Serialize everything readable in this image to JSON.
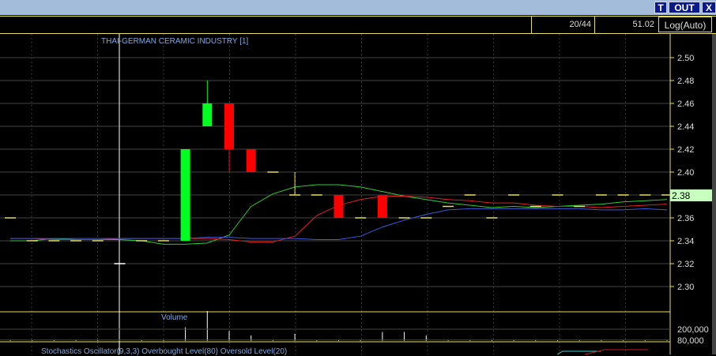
{
  "toolbar": {
    "t_label": "T",
    "out_label": "OUT",
    "x_label": "X"
  },
  "info": {
    "position": "20/44",
    "value": "51.02",
    "scale": "Log(Auto)"
  },
  "colors": {
    "up": "#00ff20",
    "down": "#ff0000",
    "ma_green": "#2ecc2e",
    "ma_red": "#e02020",
    "ma_blue": "#3a5ad8",
    "grid": "#444",
    "axis": "#e6e05a",
    "last_price_bg": "#c8ffc0"
  },
  "chart_data": {
    "type": "candlestick",
    "title": "THAI-GERMAN CERAMIC INDUSTRY [1]",
    "ylim": [
      2.29,
      2.51
    ],
    "yticks": [
      "2.50",
      "2.48",
      "2.46",
      "2.44",
      "2.42",
      "2.40",
      "2.38",
      "2.36",
      "2.34",
      "2.32",
      "2.30"
    ],
    "last_price": "2.38",
    "candles": [
      [
        2.36,
        2.36,
        2.36,
        2.36
      ],
      [
        2.34,
        2.34,
        2.34,
        2.34
      ],
      [
        2.34,
        2.34,
        2.34,
        2.34
      ],
      [
        2.34,
        2.34,
        2.34,
        2.34
      ],
      [
        2.34,
        2.34,
        2.34,
        2.34
      ],
      [
        2.32,
        2.32,
        2.32,
        2.32
      ],
      [
        2.34,
        2.34,
        2.34,
        2.34
      ],
      [
        2.34,
        2.34,
        2.34,
        2.34
      ],
      [
        2.34,
        2.42,
        2.34,
        2.42
      ],
      [
        2.44,
        2.48,
        2.44,
        2.46
      ],
      [
        2.46,
        2.46,
        2.4,
        2.42
      ],
      [
        2.42,
        2.42,
        2.4,
        2.4
      ],
      [
        2.4,
        2.4,
        2.4,
        2.4
      ],
      [
        2.38,
        2.4,
        2.38,
        2.38
      ],
      [
        2.38,
        2.38,
        2.38,
        2.38
      ],
      [
        2.38,
        2.38,
        2.36,
        2.36
      ],
      [
        2.36,
        2.36,
        2.36,
        2.36
      ],
      [
        2.38,
        2.38,
        2.36,
        2.36
      ],
      [
        2.36,
        2.36,
        2.36,
        2.36
      ],
      [
        2.36,
        2.36,
        2.36,
        2.36
      ],
      [
        2.37,
        2.37,
        2.37,
        2.37
      ],
      [
        2.38,
        2.38,
        2.38,
        2.38
      ],
      [
        2.36,
        2.36,
        2.36,
        2.36
      ],
      [
        2.38,
        2.38,
        2.38,
        2.38
      ],
      [
        2.37,
        2.37,
        2.37,
        2.37
      ],
      [
        2.38,
        2.38,
        2.38,
        2.38
      ],
      [
        2.37,
        2.37,
        2.37,
        2.37
      ],
      [
        2.38,
        2.38,
        2.38,
        2.38
      ],
      [
        2.38,
        2.38,
        2.38,
        2.38
      ],
      [
        2.38,
        2.38,
        2.38,
        2.38
      ],
      [
        2.38,
        2.38,
        2.38,
        2.38
      ]
    ],
    "series": [
      {
        "name": "ma-green",
        "values": [
          2.34,
          2.34,
          2.342,
          2.341,
          2.341,
          2.341,
          2.34,
          2.337,
          2.337,
          2.338,
          2.345,
          2.37,
          2.381,
          2.387,
          2.389,
          2.389,
          2.387,
          2.383,
          2.379,
          2.376,
          2.373,
          2.371,
          2.369,
          2.37,
          2.369,
          2.37,
          2.371,
          2.372,
          2.374,
          2.375,
          2.376
        ]
      },
      {
        "name": "ma-red",
        "values": [
          2.342,
          2.342,
          2.341,
          2.341,
          2.341,
          2.342,
          2.342,
          2.342,
          2.342,
          2.342,
          2.341,
          2.339,
          2.339,
          2.344,
          2.362,
          2.371,
          2.376,
          2.379,
          2.379,
          2.378,
          2.376,
          2.375,
          2.373,
          2.373,
          2.371,
          2.37,
          2.37,
          2.369,
          2.37,
          2.371,
          2.372
        ]
      },
      {
        "name": "ma-blue",
        "values": [
          2.342,
          2.342,
          2.342,
          2.342,
          2.342,
          2.342,
          2.342,
          2.342,
          2.342,
          2.343,
          2.343,
          2.342,
          2.342,
          2.342,
          2.341,
          2.341,
          2.344,
          2.352,
          2.358,
          2.363,
          2.367,
          2.368,
          2.368,
          2.368,
          2.368,
          2.368,
          2.368,
          2.367,
          2.367,
          2.368,
          2.367
        ]
      }
    ],
    "volume": {
      "label": "Volume",
      "ticks": [
        "200,000",
        "80,000"
      ],
      "values": [
        10000,
        10000,
        10000,
        10000,
        10000,
        0,
        10000,
        10000,
        150000,
        330000,
        110000,
        60000,
        10000,
        80000,
        10000,
        10000,
        10000,
        100000,
        100000,
        60000,
        10000,
        10000,
        10000,
        10000,
        10000,
        10000,
        10000,
        10000,
        10000,
        10000,
        10000
      ]
    },
    "stochastic": {
      "label": "Stochastics Oscillator(9,3,3) Overbought Level(80) Oversold Level(20)"
    }
  }
}
